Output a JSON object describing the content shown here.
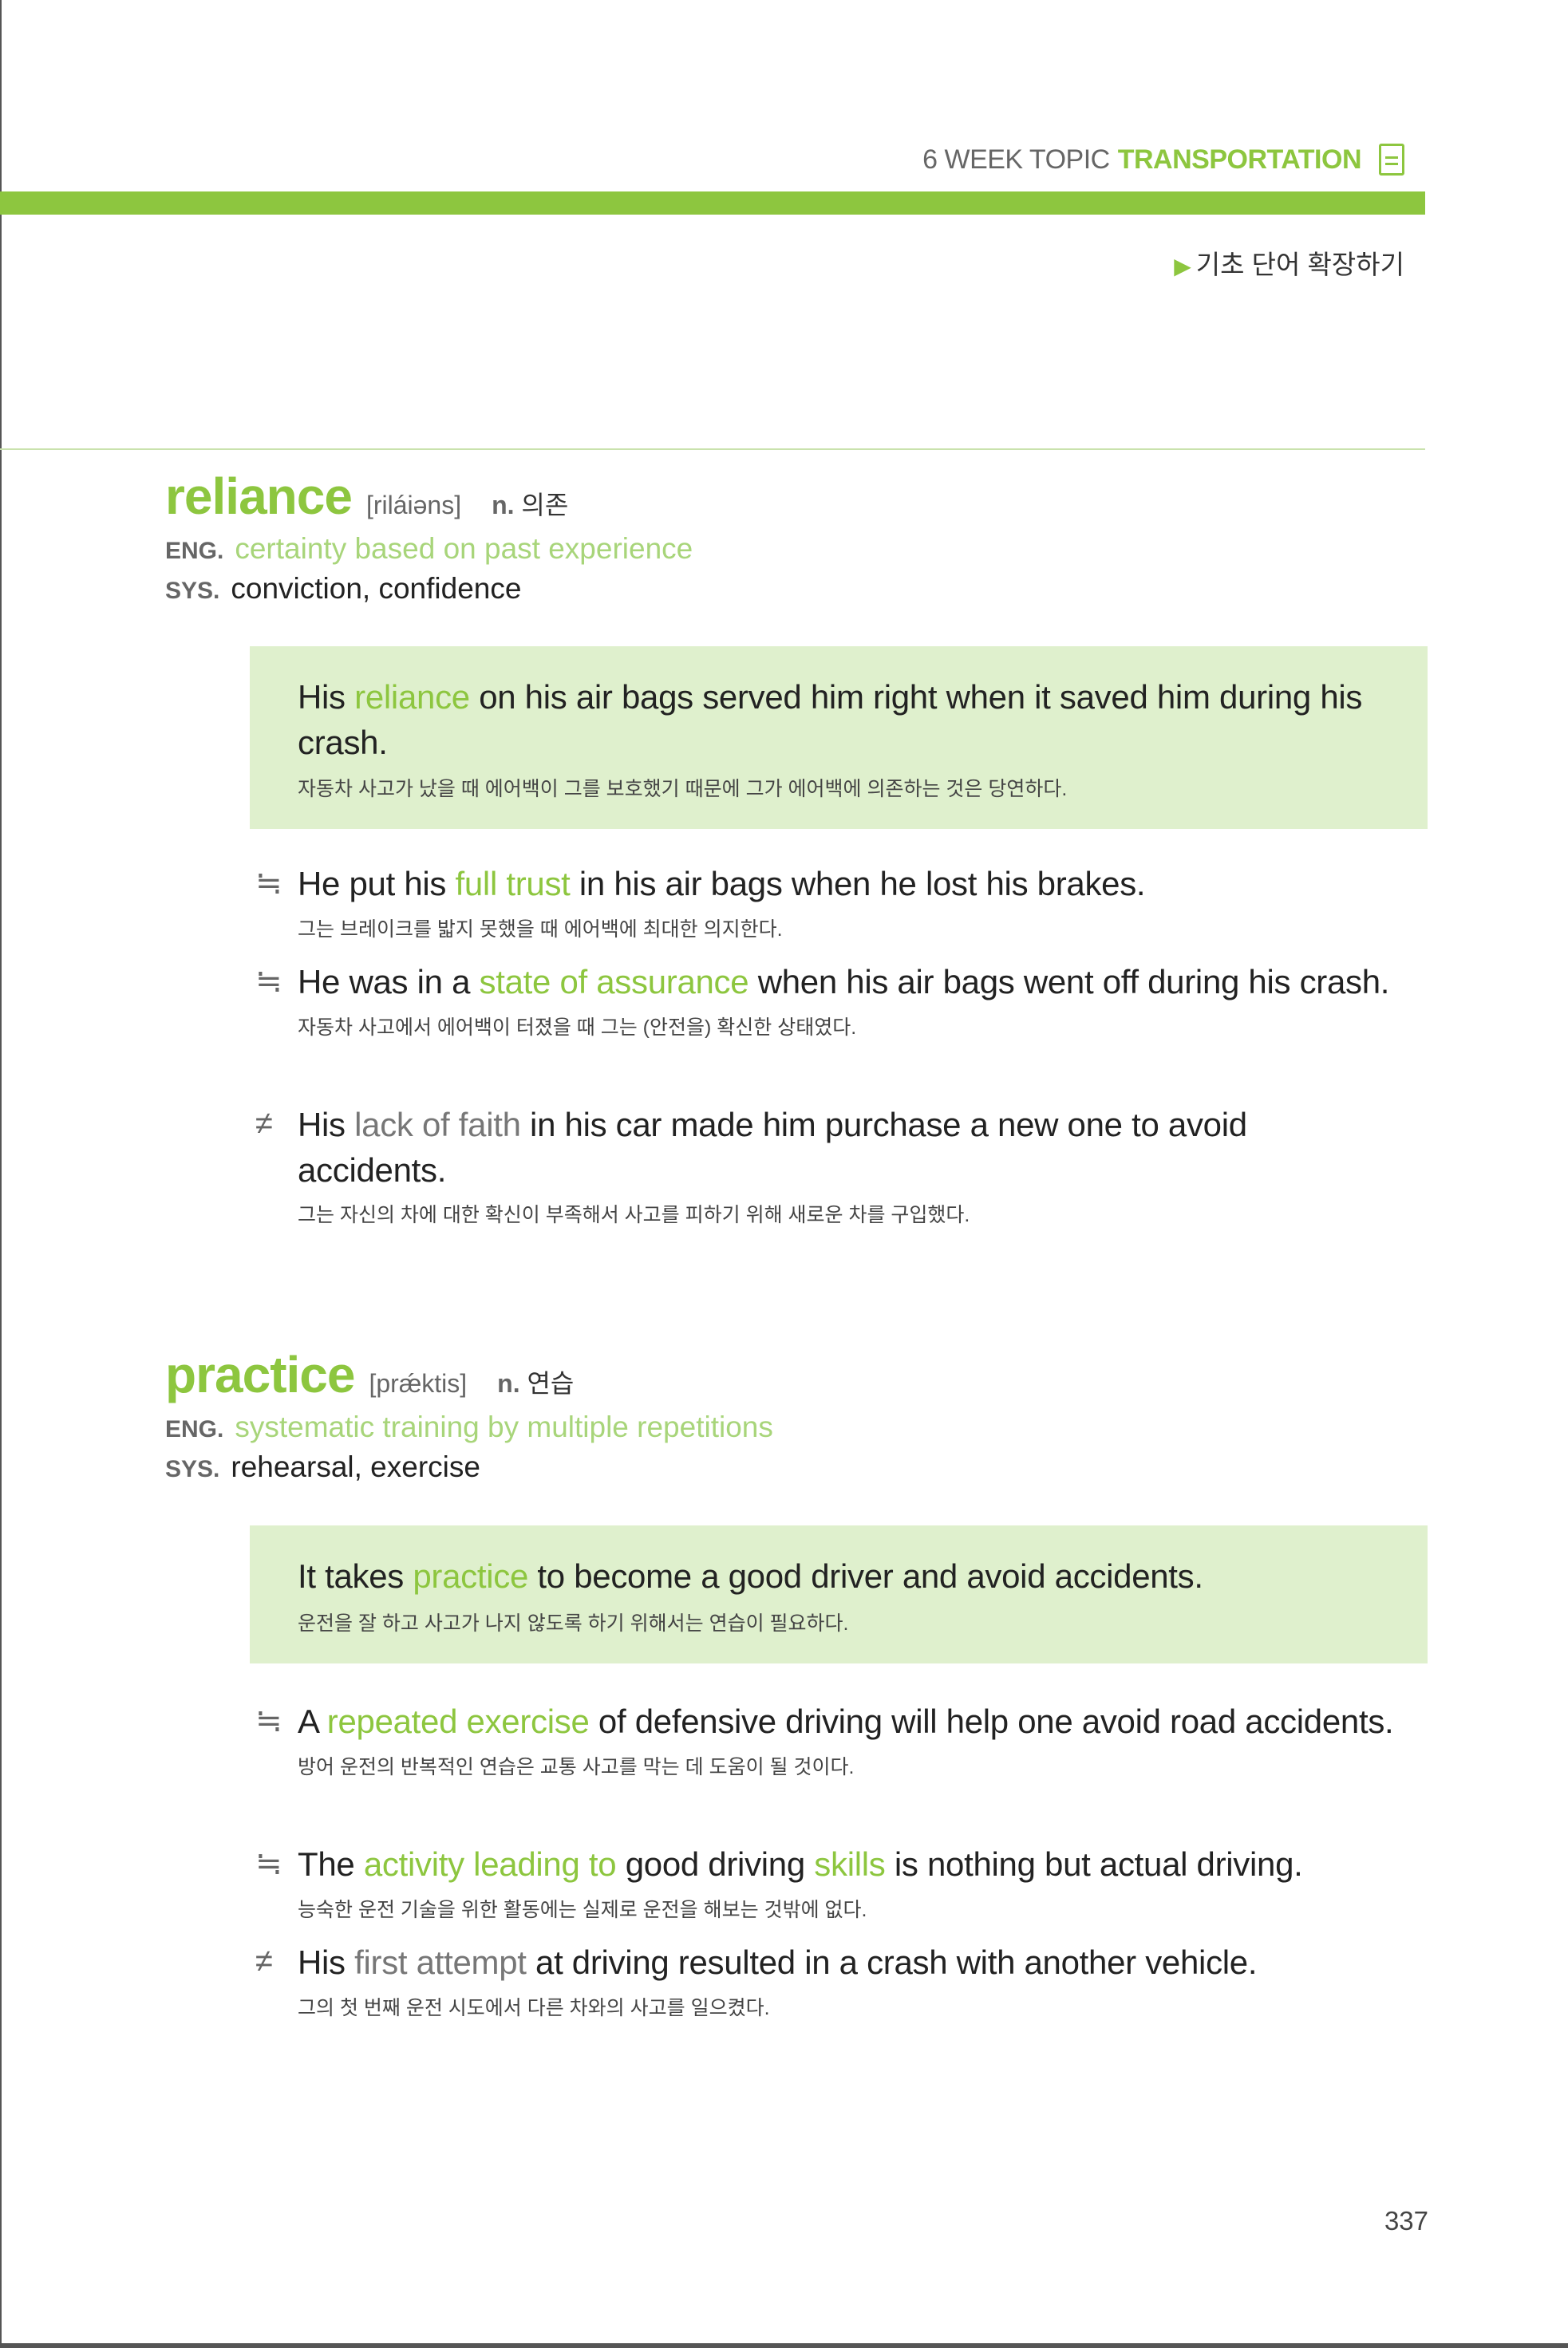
{
  "header": {
    "week": "6 WEEK TOPIC",
    "topic": "TRANSPORTATION",
    "icon": "document-icon"
  },
  "subsection": {
    "marker": "▶",
    "title": "기초 단어 확장하기"
  },
  "colors": {
    "accent": "#8dc63f",
    "box": "#dff0cd"
  },
  "entries": [
    {
      "word": "reliance",
      "pron": "[riláiəns]",
      "pos": "n.",
      "meaning": "의존",
      "eng_label": "ENG.",
      "eng": "certainty based on past experience",
      "sys_label": "SYS.",
      "sys": "conviction, confidence",
      "example": {
        "pre": "His ",
        "hl": "reliance",
        "post": " on his air bags served him right when it saved him during his crash.",
        "ko": "자동차 사고가 났을 때 에어백이 그를 보호했기 때문에 그가 에어백에 의존하는 것은 당연하다."
      },
      "related": [
        {
          "symbol": "≒",
          "pre": "He put his ",
          "hl": "full trust",
          "post": " in his air bags when he lost his brakes.",
          "ko": "그는 브레이크를 밟지 못했을 때 에어백에 최대한 의지한다."
        },
        {
          "symbol": "≒",
          "pre": "He was in a ",
          "hl": "state of assurance",
          "post": " when his air bags went off during his crash.",
          "ko": "자동차 사고에서 에어백이 터졌을 때 그는 (안전을) 확신한 상태였다."
        },
        {
          "symbol": "≠",
          "pre": "His ",
          "hl": "lack of faith",
          "post": " in his car made him purchase a new one to avoid accidents.",
          "ko": "그는 자신의 차에 대한 확신이 부족해서 사고를 피하기 위해 새로운 차를 구입했다."
        }
      ]
    },
    {
      "word": "practice",
      "pron": "[prǽktis]",
      "pos": "n.",
      "meaning": "연습",
      "eng_label": "ENG.",
      "eng": "systematic training by multiple repetitions",
      "sys_label": "SYS.",
      "sys": "rehearsal, exercise",
      "example": {
        "pre": "It takes ",
        "hl": "practice",
        "post": " to become a good driver and avoid accidents.",
        "ko": "운전을 잘 하고 사고가 나지 않도록 하기 위해서는 연습이 필요하다."
      },
      "related": [
        {
          "symbol": "≒",
          "pre": "A ",
          "hl": "repeated exercise",
          "post": " of defensive driving will help one avoid road accidents.",
          "ko": "방어 운전의 반복적인 연습은 교통 사고를 막는 데 도움이 될 것이다."
        },
        {
          "symbol": "≒",
          "pre": "The ",
          "hl": "activity leading to",
          "mid": " good driving ",
          "hl2": "skills",
          "post": " is nothing but actual driving.",
          "ko": "능숙한 운전 기술을 위한 활동에는 실제로 운전을 해보는 것밖에 없다."
        },
        {
          "symbol": "≠",
          "pre": "His ",
          "hl": "first attempt",
          "post": " at driving resulted in a crash with another vehicle.",
          "ko": "그의 첫 번째 운전 시도에서 다른 차와의 사고를 일으켰다."
        }
      ]
    }
  ],
  "page_number": "337"
}
